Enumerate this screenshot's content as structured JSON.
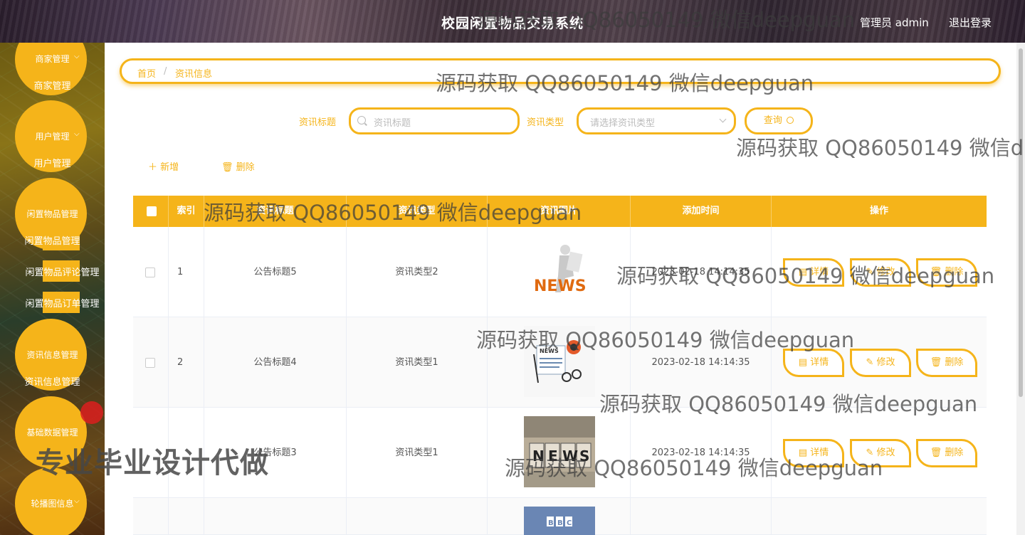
{
  "header": {
    "title": "校园闲置物品交易系统",
    "user": "管理员 admin",
    "logout": "退出登录"
  },
  "sidebar": {
    "groups": [
      {
        "label": "商家管理",
        "subs": [
          "商家管理"
        ]
      },
      {
        "label": "用户管理",
        "subs": [
          "用户管理"
        ]
      },
      {
        "label": "闲置物品管理",
        "subs": [
          "闲置物品管理",
          "闲置物品评论管理",
          "闲置物品订单管理"
        ]
      },
      {
        "label": "资讯信息管理",
        "subs": [
          "资讯信息管理"
        ]
      },
      {
        "label": "基础数据管理",
        "subs": []
      },
      {
        "label": "轮播图信息",
        "subs": []
      }
    ]
  },
  "breadcrumb": {
    "home": "首页",
    "separator": "/",
    "current": "资讯信息"
  },
  "search": {
    "title_label": "资讯标题",
    "title_placeholder": "资讯标题",
    "type_label": "资讯类型",
    "type_placeholder": "请选择资讯类型",
    "query_label": "查询"
  },
  "toolbar": {
    "add_label": "新增",
    "delete_label": "删除"
  },
  "table": {
    "headers": [
      "索引",
      "资讯标题",
      "资讯类型",
      "资讯图片",
      "添加时间",
      "操作"
    ],
    "rows": [
      {
        "index": "1",
        "title": "公告标题5",
        "type": "资讯类型2",
        "image": "news-figure",
        "time": "2023-02-18 14:14:35"
      },
      {
        "index": "2",
        "title": "公告标题4",
        "type": "资讯类型1",
        "image": "newspaper-glasses",
        "time": "2023-02-18 14:14:35"
      },
      {
        "index": "",
        "title": "公告标题3",
        "type": "资讯类型1",
        "image": "news-blocks",
        "time": "2023-02-18 14:14:35"
      },
      {
        "index": "",
        "title": "",
        "type": "",
        "image": "bbc-sign",
        "time": ""
      }
    ],
    "actions": {
      "detail": "详情",
      "edit": "修改",
      "delete": "删除"
    }
  },
  "watermarks": [
    "源码获取 QQ86050149 微信deepguan",
    "源码获取 QQ86050149 微信deepguan",
    "源码获取 QQ86050149 微信d",
    "源码获取 QQ86050149 微信deepguan",
    "源码获取 QQ86050149 微信deepguan",
    "源码获取 QQ86050149 微信deepguan",
    "源码获取 QQ86050149 微信deepguan",
    "源码获取 QQ86050149 微信deepguan",
    "专业毕业设计代做"
  ],
  "colors": {
    "accent": "#f5b41a",
    "header_text": "#ffffff"
  }
}
